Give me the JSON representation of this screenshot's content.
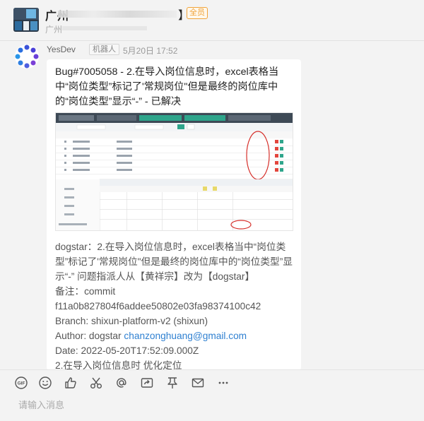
{
  "header": {
    "group_name_prefix": "广州",
    "bracket": "】",
    "badge": "全员",
    "subtitle_prefix": "广州"
  },
  "message": {
    "sender": "YesDev",
    "tag": "机器人",
    "time": "5月20日 17:52",
    "title": "Bug#7005058 - 2.在导入岗位信息时，excel表格当中“岗位类型”标记了'常规岗位\"但是最终的岗位库中的“岗位类型”显示“-” - 已解决",
    "body": {
      "line1": "dogstar：2.在导入岗位信息时，excel表格当中“岗位类型”标记了'常规岗位\"但是最终的岗位库中的“岗位类型”显示“-” 问题指派人从【黄祥宗】改为【dogstar】",
      "note": "备注：commit f11a0b827804f6addee50802e03fa98374100c42",
      "branch": "Branch: shixun-platform-v2 (shixun)",
      "author_label": "Author: dogstar ",
      "author_email": "chanzonghuang@gmail.com",
      "date": "Date: 2022-05-20T17:52:09.000Z",
      "last": "2.在导入岗位信息时 优化定位"
    }
  },
  "toolbar": {
    "icons": [
      "gif-icon",
      "emoji-icon",
      "thumbs-up-icon",
      "scissors-icon",
      "at-icon",
      "forward-icon",
      "pin-icon",
      "mail-icon",
      "more-icon"
    ]
  },
  "input": {
    "placeholder": "请输入消息"
  },
  "colors": {
    "badge": "#f0a33a",
    "link": "#2f80d1",
    "background": "#f3f3f3"
  }
}
